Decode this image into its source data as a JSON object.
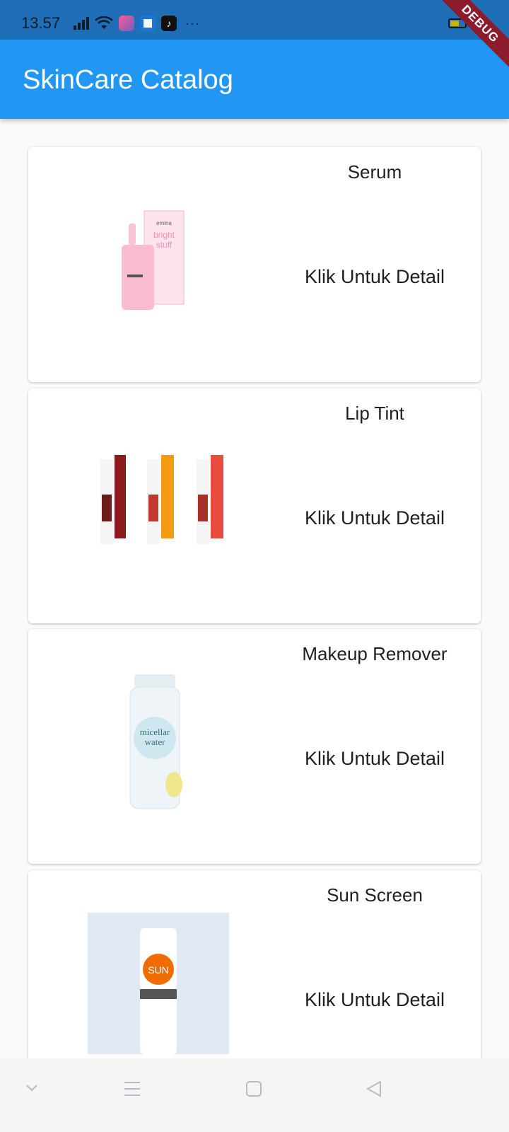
{
  "status_bar": {
    "time": "13.57",
    "icons": [
      "signal-icon",
      "wifi-icon",
      "app-icon-1",
      "app-icon-2",
      "tiktok-icon",
      "more-dots-icon",
      "battery-icon",
      "charging-icon"
    ],
    "more": "···"
  },
  "debug_banner": "DEBUG",
  "app_bar": {
    "title": "SkinCare Catalog",
    "color": "#2196f3"
  },
  "products": [
    {
      "name": "Serum",
      "action": "Klik Untuk Detail",
      "image": "serum-image"
    },
    {
      "name": "Lip Tint",
      "action": "Klik Untuk Detail",
      "image": "lip-tint-image"
    },
    {
      "name": "Makeup Remover",
      "action": "Klik Untuk Detail",
      "image": "makeup-remover-image"
    },
    {
      "name": "Sun Screen",
      "action": "Klik Untuk Detail",
      "image": "sun-screen-image"
    }
  ],
  "nav_bar": {
    "icons": [
      "chevron-down-icon",
      "menu-icon",
      "home-square-icon",
      "back-triangle-icon"
    ]
  }
}
